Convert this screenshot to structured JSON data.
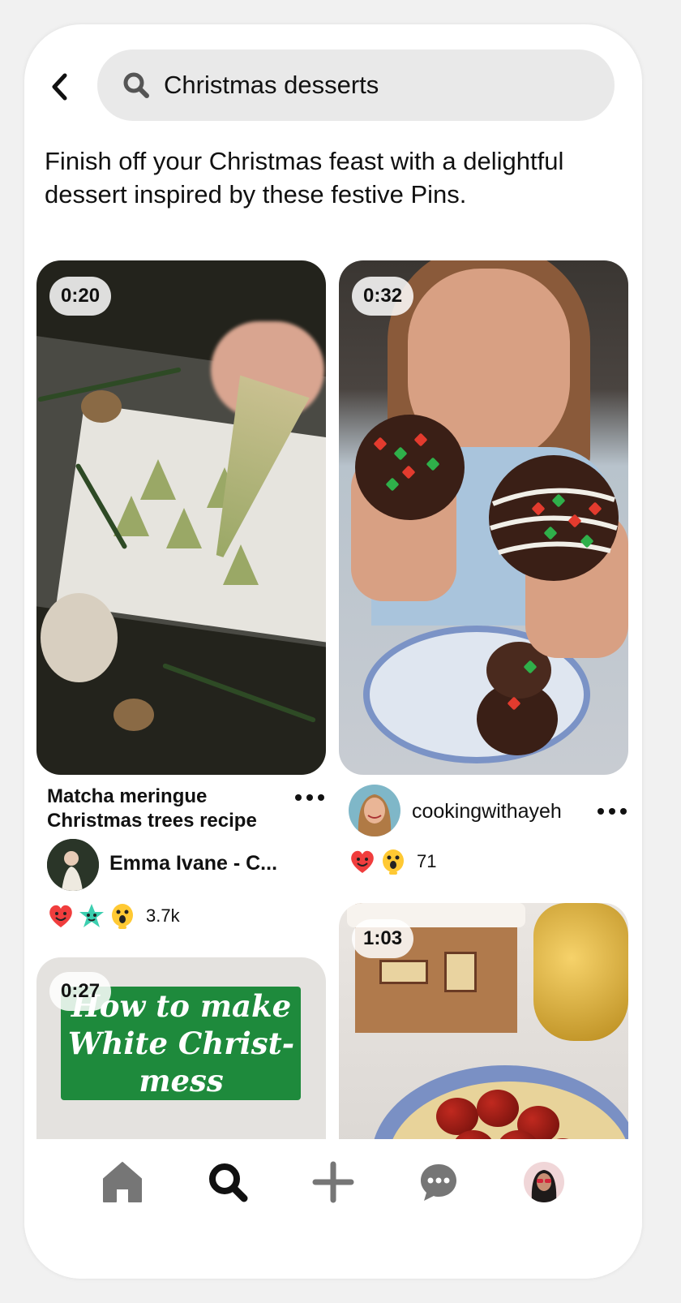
{
  "search": {
    "query": "Christmas desserts"
  },
  "intro": {
    "text": "Finish off your Christmas feast with a delightful dessert inspired by these festive Pins."
  },
  "pins": [
    {
      "duration": "0:20",
      "title": "Matcha meringue Christmas trees recipe",
      "creator": "Emma Ivane - C...",
      "reaction_count": "3.7k",
      "reactions": [
        "heart-eyes-reaction",
        "star-reaction",
        "wow-reaction"
      ]
    },
    {
      "duration": "0:32",
      "creator": "cookingwithayeh",
      "reaction_count": "71",
      "reactions": [
        "heart-eyes-reaction",
        "wow-reaction"
      ]
    },
    {
      "duration": "0:27",
      "overlay_text": [
        "How to make",
        "White Christ-",
        "mess"
      ]
    },
    {
      "duration": "1:03"
    }
  ],
  "nav": [
    "home-icon",
    "search-icon",
    "plus-icon",
    "messages-icon",
    "profile-avatar"
  ],
  "colors": {
    "accent": "#e60023",
    "search_bg": "#e9e9e9",
    "nav_active": "#111111",
    "nav_inactive": "#767676"
  }
}
